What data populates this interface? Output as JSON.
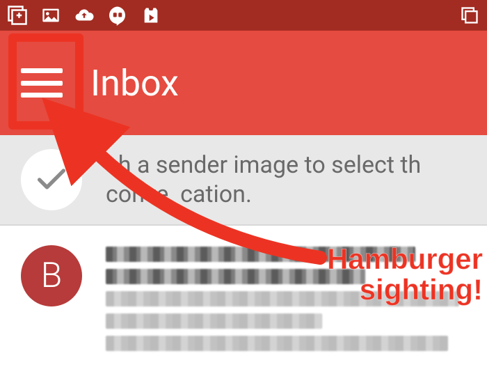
{
  "colors": {
    "statusbar": "#a22c22",
    "appbar": "#e54b40",
    "accent": "#ec3323",
    "tipbg": "#e8e8e8",
    "avatar": "#b63b3a"
  },
  "statusbar": {
    "icons": [
      "gplus-icon",
      "gallery-icon",
      "cloud-upload-icon",
      "hangouts-icon",
      "play-store-icon"
    ],
    "right_icon": "copy-icon"
  },
  "appbar": {
    "title": "Inbox",
    "menu_icon": "hamburger-icon"
  },
  "tip": {
    "icon": "checkmark-icon",
    "text": "ch a sender image to select th\nconve  cation."
  },
  "emails": [
    {
      "avatar_letter": "B"
    }
  ],
  "annotation": {
    "label": "Hamburger\nsighting!"
  }
}
